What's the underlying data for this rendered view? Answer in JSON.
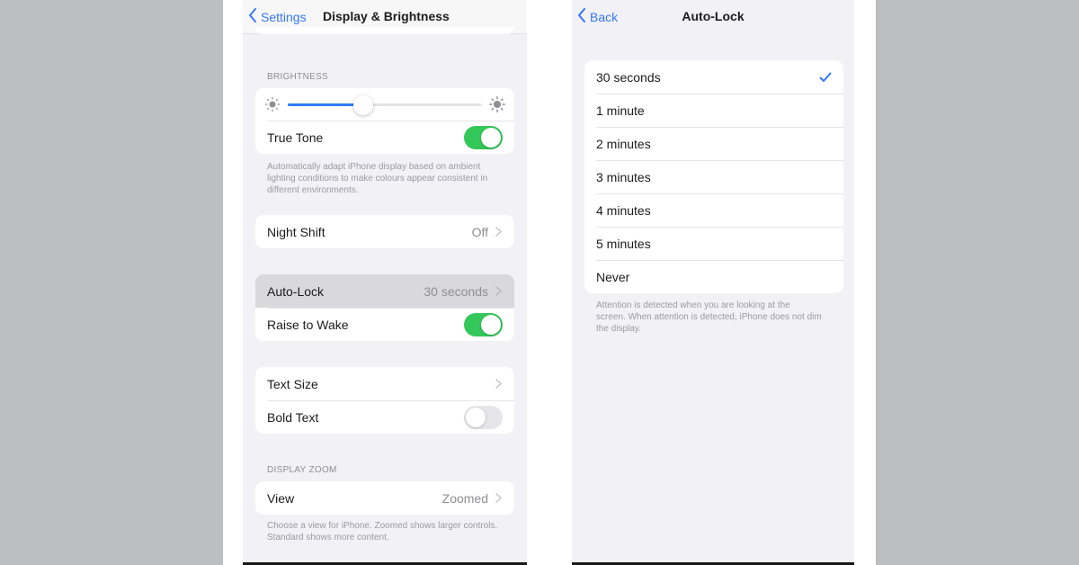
{
  "left_screen": {
    "nav": {
      "back_label": "Settings",
      "title": "Display & Brightness"
    },
    "brightness": {
      "header": "BRIGHTNESS",
      "level": 0.39,
      "true_tone": {
        "label": "True Tone",
        "on": true
      },
      "footnote": "Automatically adapt iPhone display based on ambient lighting conditions to make colours appear consistent in different environments."
    },
    "night_shift": {
      "label": "Night Shift",
      "value": "Off"
    },
    "auto_lock": {
      "label": "Auto-Lock",
      "value": "30 seconds"
    },
    "raise_to_wake": {
      "label": "Raise to Wake",
      "on": true
    },
    "text_size": {
      "label": "Text Size"
    },
    "bold_text": {
      "label": "Bold Text",
      "on": false
    },
    "display_zoom": {
      "header": "DISPLAY ZOOM",
      "view": {
        "label": "View",
        "value": "Zoomed"
      },
      "footnote": "Choose a view for iPhone. Zoomed shows larger controls. Standard shows more content."
    }
  },
  "right_screen": {
    "nav": {
      "back_label": "Back",
      "title": "Auto-Lock"
    },
    "options": [
      {
        "label": "30 seconds",
        "selected": true
      },
      {
        "label": "1 minute",
        "selected": false
      },
      {
        "label": "2 minutes",
        "selected": false
      },
      {
        "label": "3 minutes",
        "selected": false
      },
      {
        "label": "4 minutes",
        "selected": false
      },
      {
        "label": "5 minutes",
        "selected": false
      },
      {
        "label": "Never",
        "selected": false
      }
    ],
    "footnote": "Attention is detected when you are looking at the screen. When attention is detected, iPhone does not dim the display."
  },
  "colors": {
    "accent": "#3478f6",
    "toggle_on": "#34c759",
    "background": "#f1f1f6"
  }
}
